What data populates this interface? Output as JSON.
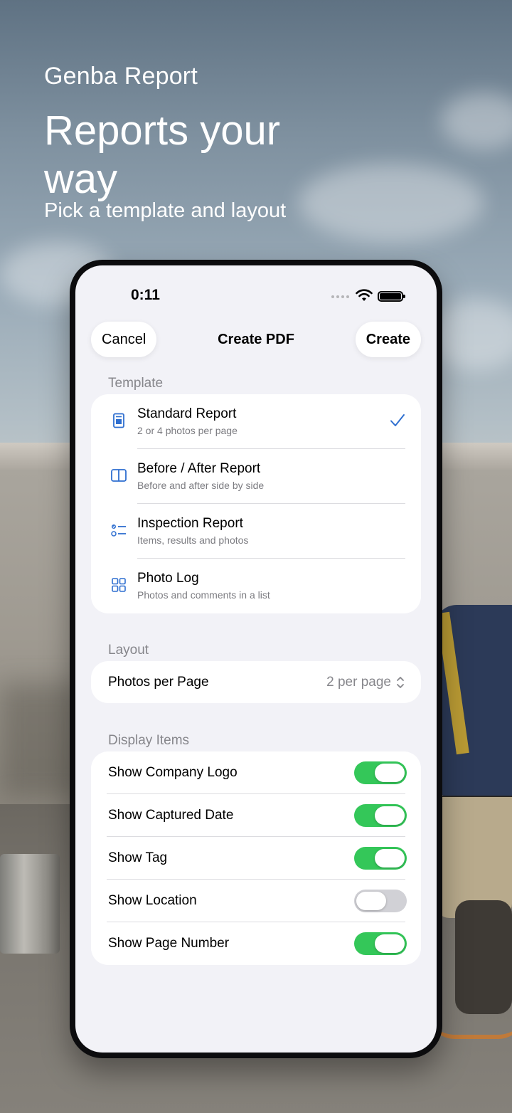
{
  "hero": {
    "brand": "Genba Report",
    "headline": "Reports your way",
    "subhead": "Pick a template and layout"
  },
  "status_bar": {
    "time": "0:11"
  },
  "nav": {
    "cancel_label": "Cancel",
    "title": "Create PDF",
    "create_label": "Create"
  },
  "template_section": {
    "label": "Template",
    "items": [
      {
        "title": "Standard Report",
        "subtitle": "2 or 4 photos per page",
        "icon": "document-icon",
        "selected": true
      },
      {
        "title": "Before / After Report",
        "subtitle": "Before and after side by side",
        "icon": "split-view-icon",
        "selected": false
      },
      {
        "title": "Inspection Report",
        "subtitle": "Items, results and photos",
        "icon": "checklist-icon",
        "selected": false
      },
      {
        "title": "Photo Log",
        "subtitle": "Photos and comments in a list",
        "icon": "grid-icon",
        "selected": false
      }
    ]
  },
  "layout_section": {
    "label": "Layout",
    "photos_per_page_label": "Photos per Page",
    "photos_per_page_value": "2 per page"
  },
  "display_section": {
    "label": "Display Items",
    "items": [
      {
        "label": "Show Company Logo",
        "on": true
      },
      {
        "label": "Show Captured Date",
        "on": true
      },
      {
        "label": "Show Tag",
        "on": true
      },
      {
        "label": "Show Location",
        "on": false
      },
      {
        "label": "Show Page Number",
        "on": true
      }
    ]
  },
  "colors": {
    "accent": "#2f6fd0",
    "toggle_on": "#34c759",
    "toggle_off": "#d1d1d6",
    "background": "#f2f2f7"
  }
}
